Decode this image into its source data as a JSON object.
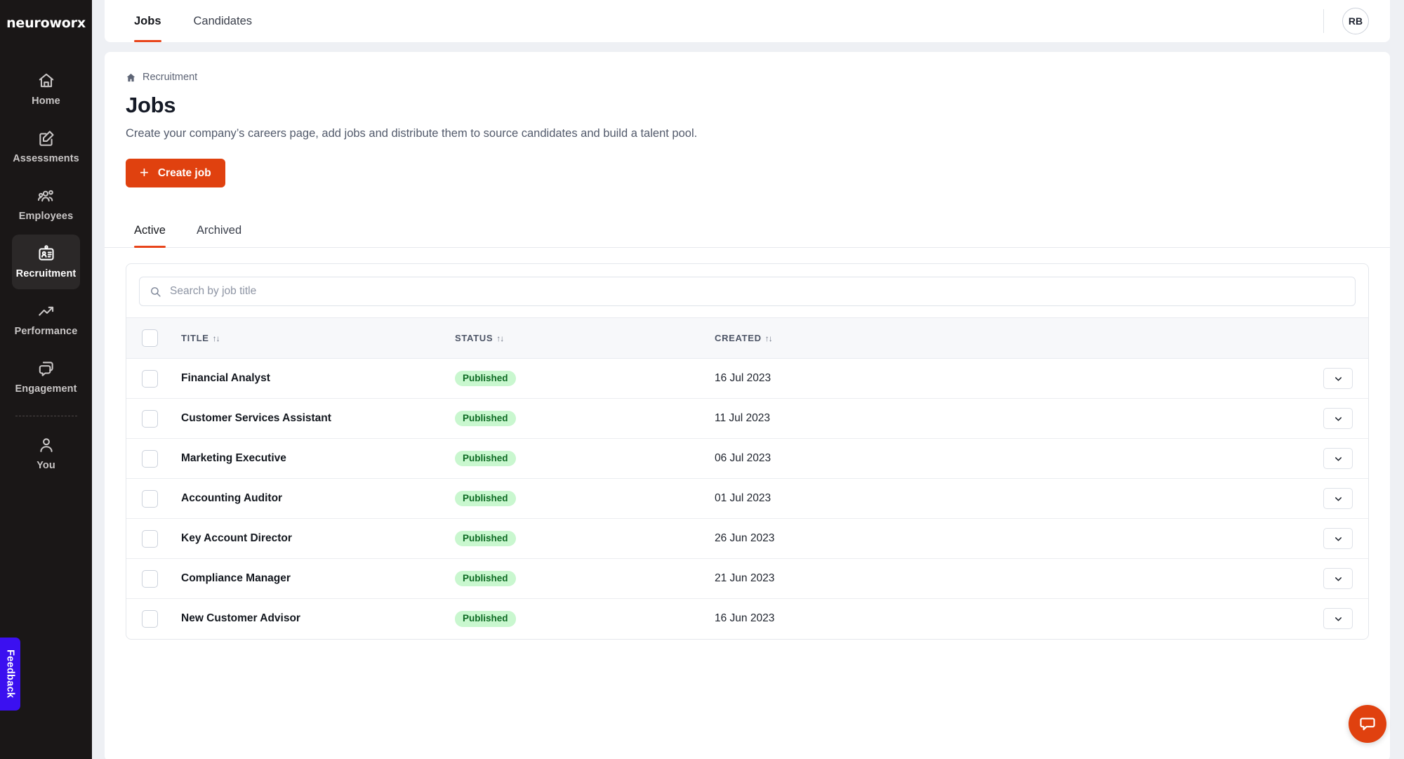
{
  "brand": {
    "name": "neuroworx"
  },
  "sidebar": {
    "items": [
      {
        "label": "Home",
        "icon": "home-icon",
        "active": false
      },
      {
        "label": "Assessments",
        "icon": "edit-square-icon",
        "active": false
      },
      {
        "label": "Employees",
        "icon": "people-group-icon",
        "active": false
      },
      {
        "label": "Recruitment",
        "icon": "id-badge-icon",
        "active": true
      },
      {
        "label": "Performance",
        "icon": "trending-up-icon",
        "active": false
      },
      {
        "label": "Engagement",
        "icon": "chat-bubbles-icon",
        "active": false
      },
      {
        "label": "You",
        "icon": "user-icon",
        "active": false
      }
    ],
    "feedback_label": "Feedback"
  },
  "topbar": {
    "tabs": [
      {
        "label": "Jobs",
        "active": true
      },
      {
        "label": "Candidates",
        "active": false
      }
    ],
    "avatar_initials": "RB"
  },
  "breadcrumb": {
    "icon": "home-icon",
    "label": "Recruitment"
  },
  "page": {
    "title": "Jobs",
    "subtitle": "Create your company’s careers page, add jobs and distribute them to source candidates and build a talent pool.",
    "create_button": "Create job",
    "create_button_icon": "plus-icon"
  },
  "subtabs": [
    {
      "label": "Active",
      "active": true
    },
    {
      "label": "Archived",
      "active": false
    }
  ],
  "search": {
    "placeholder": "Search by job title",
    "value": "",
    "icon": "search-icon"
  },
  "table": {
    "columns": [
      {
        "key": "select",
        "label": ""
      },
      {
        "key": "title",
        "label": "TITLE",
        "sortable": true
      },
      {
        "key": "status",
        "label": "STATUS",
        "sortable": true
      },
      {
        "key": "created",
        "label": "CREATED",
        "sortable": true
      },
      {
        "key": "action",
        "label": ""
      }
    ],
    "sort_icon": "↑↓",
    "row_action_icon": "chevron-down-icon",
    "rows": [
      {
        "title": "Financial Analyst",
        "status": "Published",
        "created": "16 Jul 2023"
      },
      {
        "title": "Customer Services Assistant",
        "status": "Published",
        "created": "11 Jul 2023"
      },
      {
        "title": "Marketing Executive",
        "status": "Published",
        "created": "06 Jul 2023"
      },
      {
        "title": "Accounting Auditor",
        "status": "Published",
        "created": "01 Jul 2023"
      },
      {
        "title": "Key Account Director",
        "status": "Published",
        "created": "26 Jun 2023"
      },
      {
        "title": "Compliance Manager",
        "status": "Published",
        "created": "21 Jun 2023"
      },
      {
        "title": "New Customer Advisor",
        "status": "Published",
        "created": "16 Jun 2023"
      }
    ]
  },
  "chat_widget": {
    "icon": "chat-bubble-icon"
  },
  "colors": {
    "accent": "#e0410f",
    "sidebar_bg": "#1a1717",
    "badge_bg": "#c9f7cf",
    "badge_text": "#0d6b23",
    "feedback_bg": "#3b10f0",
    "page_bg": "#eef0f4"
  }
}
